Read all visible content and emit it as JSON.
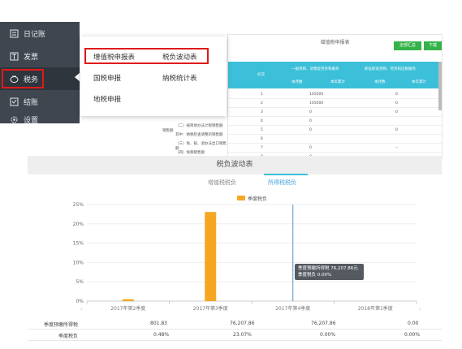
{
  "sidebar": {
    "items": [
      {
        "label": "日记账",
        "icon": "journal-icon"
      },
      {
        "label": "发票",
        "icon": "invoice-icon"
      },
      {
        "label": "税务",
        "icon": "tax-icon",
        "active": true
      },
      {
        "label": "结账",
        "icon": "checkout-icon"
      },
      {
        "label": "设置",
        "icon": "gear-icon"
      }
    ]
  },
  "menu": {
    "items": [
      "增值税申报表",
      "税负波动表",
      "国税申报",
      "纳税统计表",
      "地税申报"
    ]
  },
  "background_table": {
    "title": "增值税申报表",
    "buttons": [
      "全部汇总",
      "下载"
    ],
    "head_col1": "栏次",
    "head_group1": "一般项目、货物及劳务和服务",
    "head_group2": "即征即退货物、劳务和应税服务",
    "sub_cols": [
      "本月数",
      "本年累计",
      "本月数",
      "本年累计"
    ],
    "rows": [
      {
        "n": "1",
        "v1": "105000",
        "v3": "0"
      },
      {
        "n": "2",
        "v1": "105000",
        "v3": "0"
      },
      {
        "n": "3",
        "v1": "0",
        "v3": "0"
      },
      {
        "n": "4",
        "v1": "0",
        "v3": ""
      },
      {
        "n": "5",
        "v1": "0",
        "v3": "0"
      },
      {
        "n": "6",
        "v1": "",
        "v3": ""
      },
      {
        "n": "7",
        "v1": "0",
        "v3": "--"
      },
      {
        "n": "8",
        "v1": "0",
        "v3": "--"
      }
    ],
    "left_labels": [
      "（二）按简易办法计税销售额",
      "其中：纳税检查调整的销售额",
      "（三）免、抵、退办法出口销售额",
      "（四）免税销售额"
    ],
    "side_label": "销售额"
  },
  "panel": {
    "title": "税负波动表",
    "tabs": [
      "增值税税负",
      "所得税税负"
    ],
    "active_tab": 1,
    "legend": "季度税负",
    "tooltip_line1": "季度预缴所得税 76,207.86元",
    "tooltip_line2": "季度税负 0.00%"
  },
  "chart_data": {
    "type": "bar",
    "categories": [
      "2017年第2季度",
      "2017年第3季度",
      "2017年第4季度",
      "2018年第1季度"
    ],
    "series": [
      {
        "name": "季度税负",
        "values": [
          0.48,
          23.07,
          0.0,
          0.0
        ]
      }
    ],
    "ylim": [
      0,
      25
    ],
    "yticks": [
      "0%",
      "5%",
      "10%",
      "15%",
      "20%",
      "25%"
    ],
    "color": "#f5a623"
  },
  "bottom_table": {
    "rows": [
      {
        "label": "季度预缴所得税",
        "values": [
          "801.83",
          "76,207.86",
          "76,207.86",
          "0.00"
        ]
      },
      {
        "label": "季度税负",
        "values": [
          "0.48%",
          "23.07%",
          "0.00%",
          "0.00%"
        ]
      }
    ]
  },
  "colors": {
    "sidebar": "#3f4650",
    "accent": "#3cc0d9",
    "bar": "#f5a623",
    "highlight": "#e01919"
  }
}
